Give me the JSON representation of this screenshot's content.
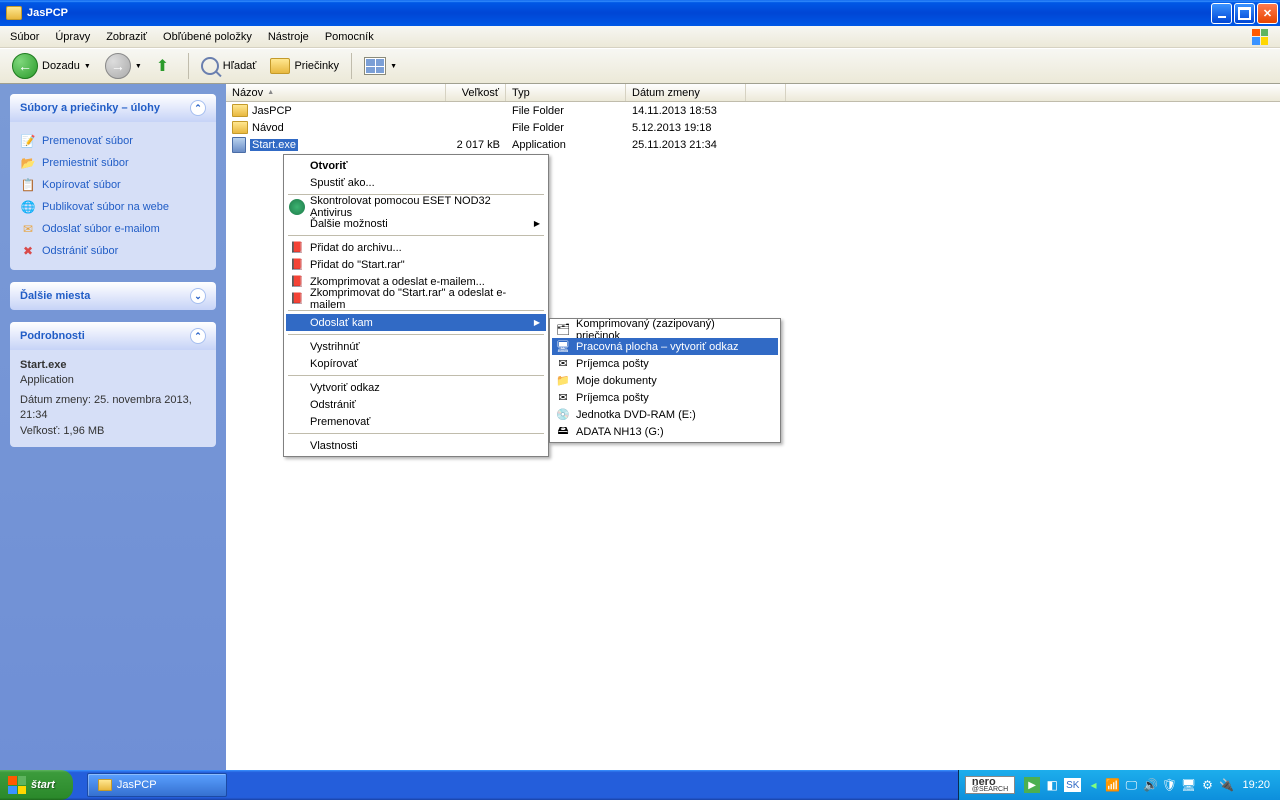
{
  "window": {
    "title": "JasPCP"
  },
  "menubar": [
    "Súbor",
    "Úpravy",
    "Zobraziť",
    "Obľúbené položky",
    "Nástroje",
    "Pomocník"
  ],
  "toolbar": {
    "back": "Dozadu",
    "search": "Hľadať",
    "folders": "Priečinky"
  },
  "columns": {
    "name": "Názov",
    "size": "Veľkosť",
    "type": "Typ",
    "date": "Dátum zmeny"
  },
  "files": [
    {
      "name": "JasPCP",
      "size": "",
      "type": "File Folder",
      "date": "14.11.2013 18:53",
      "icon": "folder"
    },
    {
      "name": "Návod",
      "size": "",
      "type": "File Folder",
      "date": "5.12.2013 19:18",
      "icon": "folder"
    },
    {
      "name": "Start.exe",
      "size": "2 017 kB",
      "type": "Application",
      "date": "25.11.2013 21:34",
      "icon": "exe",
      "selected": true
    }
  ],
  "sidepanel": {
    "tasks_title": "Súbory a priečinky – úlohy",
    "tasks": [
      "Premenovať súbor",
      "Premiestniť súbor",
      "Kopírovať súbor",
      "Publikovať súbor na webe",
      "Odoslať súbor e-mailom",
      "Odstrániť súbor"
    ],
    "places_title": "Ďalšie miesta",
    "details_title": "Podrobnosti",
    "details": {
      "name": "Start.exe",
      "type": "Application",
      "date": "Dátum zmeny: 25. novembra 2013, 21:34",
      "size": "Veľkosť: 1,96 MB"
    }
  },
  "ctx1": {
    "open": "Otvoriť",
    "runas": "Spustiť ako...",
    "eset": "Skontrolovat pomocou ESET NOD32 Antivirus",
    "more": "Ďalšie možnosti",
    "arch1": "Přidat do archivu...",
    "arch2": "Přidat do \"Start.rar\"",
    "arch3": "Zkomprimovat a odeslat e-mailem...",
    "arch4": "Zkomprimovat do \"Start.rar\" a odeslat e-mailem",
    "sendto": "Odoslať kam",
    "cut": "Vystrihnúť",
    "copy": "Kopírovať",
    "shortcut": "Vytvoriť odkaz",
    "delete": "Odstrániť",
    "rename": "Premenovať",
    "props": "Vlastnosti"
  },
  "ctx2": {
    "zip": "Komprimovaný (zazipovaný) priečinok",
    "desktop": "Pracovná plocha – vytvoriť odkaz",
    "mail1": "Príjemca pošty",
    "docs": "Moje dokumenty",
    "mail2": "Príjemca pošty",
    "dvd": "Jednotka DVD-RAM (E:)",
    "adata": "ADATA NH13 (G:)"
  },
  "taskbar": {
    "start": "štart",
    "app": "JasPCP",
    "lang": "SK",
    "clock": "19:20",
    "nero1": "nero",
    "nero2": "@SEARCH"
  }
}
